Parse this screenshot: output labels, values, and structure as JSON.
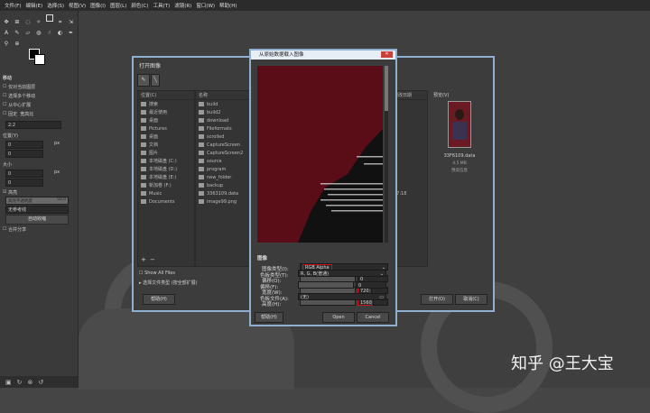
{
  "menubar": {
    "items": [
      "文件(F)",
      "编辑(E)",
      "选择(S)",
      "视图(V)",
      "图像(I)",
      "图层(L)",
      "颜色(C)",
      "工具(T)",
      "滤镜(R)",
      "窗口(W)",
      "帮助(H)"
    ]
  },
  "toolbox": {
    "options_title": "移动",
    "opt_labels": [
      "仅对当前图层",
      "选择多个移动",
      "从中心扩展"
    ],
    "mode_label": "模式",
    "mode_value": "正常",
    "fixed_label": "固定",
    "fixed_value": "宽高比",
    "ratio_value": "2:2",
    "pos_label": "位置(Y)",
    "unit": "px",
    "size_label": "大小",
    "pos_x": "0",
    "pos_y": "0",
    "size_x": "0",
    "size_y": "0",
    "highlight_label": "高亮",
    "opacity_label": "高亮不透明度",
    "opacity_value": "50.0",
    "guides_value": "无参考线",
    "autoshrink_button": "自动收缩",
    "merged_label": "合并分享"
  },
  "open_dialog": {
    "title": "打开图像",
    "places_header": "位置(C)",
    "name_header": "名称",
    "size_header": "修改日期",
    "preview_header": "预览(V)",
    "places": [
      "搜索",
      "最近使用",
      "桌面",
      "Pictures",
      "桌面",
      "文档",
      "图片",
      "本地磁盘 (C:)",
      "本地磁盘 (D:)",
      "本地磁盘 (E:)",
      "新加卷 (F:)",
      "Music",
      "Documents"
    ],
    "files": [
      "build",
      "build2",
      "download",
      "Fileformats",
      "scrolled",
      "CaptureScreen",
      "CaptureScreen2",
      "source",
      "program",
      "new_folder",
      "backup",
      "3363109.data",
      "image99.png"
    ],
    "dates": [
      "",
      "",
      "",
      "",
      "",
      "",
      "",
      "",
      "",
      "",
      "",
      "17:18",
      ""
    ],
    "preview_filename": "33F6109.data",
    "preview_size": "4.5 MB",
    "preview_info": "预览信息",
    "show_all": "Show All Files",
    "file_type": "选择文件类型 (按全部扩展)",
    "help_button": "帮助(H)",
    "open_button": "打开(O)",
    "cancel_button": "取消(C)"
  },
  "import_dialog": {
    "title": "从原始数据载入图像",
    "image_section": "图像",
    "image_type_label": "图像类型(I):",
    "image_type_value": "RGB Alpha",
    "offset_label": "偏移(O):",
    "offset_value": "0",
    "width_label": "宽度(W):",
    "width_value": "720",
    "height_label": "高度(H):",
    "height_value": "1560",
    "palette_section": "色板",
    "palette_type_label": "色板类型(T):",
    "palette_type_value": "R, G, B(普通)",
    "palette_offset_label": "偏移(F):",
    "palette_offset_value": "0",
    "palette_file_label": "色板文件(A):",
    "palette_file_value": "(无)",
    "help_button": "帮助(H)",
    "open_button": "Open",
    "cancel_button": "Cancel",
    "close_glyph": "✕"
  },
  "watermark": "知乎 @王大宝",
  "colors": {
    "highlight": "#d0101a",
    "preview_bg": "#5a0d17"
  }
}
